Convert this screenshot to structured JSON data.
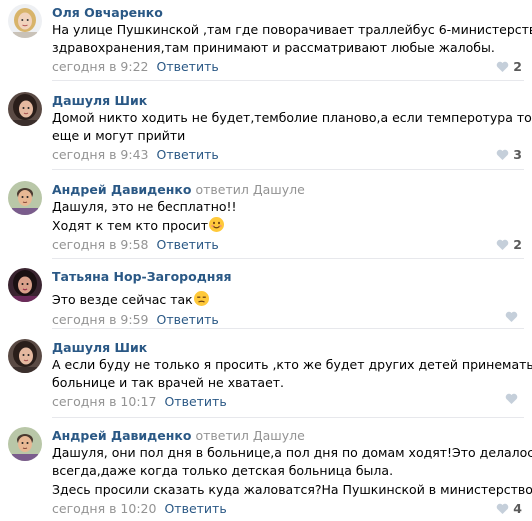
{
  "comments": [
    {
      "author": "Оля Овчаренко",
      "reply_prefix": "",
      "reply_to": "",
      "lines": [
        "На улице Пушкинской ,там где поворачивает траллейбус 6-министерство",
        "здравохранения,там принимают и рассматривают любые жалобы."
      ],
      "date": "сегодня в 9:22",
      "reply_label": "Ответить",
      "likes": "2",
      "avatar_icon": "blonde-woman-avatar-icon"
    },
    {
      "author": "Дашуля Шик",
      "reply_prefix": "",
      "reply_to": "",
      "lines": [
        "Домой никто ходить не будет,темболие планово,а если темперотура тогда",
        "еще и могут прийти"
      ],
      "date": "сегодня в 9:43",
      "reply_label": "Ответить",
      "likes": "3",
      "avatar_icon": "dark-hair-woman-avatar-icon"
    },
    {
      "author": "Андрей Давиденко",
      "reply_prefix": "ответил",
      "reply_to": "Дашуле",
      "lines": [
        "Дашуля, это не бесплатно!!",
        "Ходят к тем кто просит"
      ],
      "emoji_after_line": 1,
      "emoji": "smiling-face-emoji",
      "date": "сегодня в 9:58",
      "reply_label": "Ответить",
      "likes": "2",
      "avatar_icon": "man-avatar-icon"
    },
    {
      "author": "Татьяна Нор-Загородняя",
      "reply_prefix": "",
      "reply_to": "",
      "lines": [
        "Это везде сейчас так"
      ],
      "emoji_after_line": 0,
      "emoji": "unamused-face-emoji",
      "date": "сегодня в 9:59",
      "reply_label": "Ответить",
      "likes": "",
      "avatar_icon": "woman-purple-avatar-icon"
    },
    {
      "author": "Дашуля Шик",
      "reply_prefix": "",
      "reply_to": "",
      "lines": [
        "А если буду не только я просить ,кто же будет других детей принемать?В",
        "больнице и так врачей не хватает."
      ],
      "date": "сегодня в 10:17",
      "reply_label": "Ответить",
      "likes": "",
      "avatar_icon": "dark-hair-woman-avatar-icon"
    },
    {
      "author": "Андрей Давиденко",
      "reply_prefix": "ответил",
      "reply_to": "Дашуле",
      "lines": [
        "Дашуля, они пол дня в больнице,а пол дня по домам ходят!Это делалось",
        "всегда,даже когда только детская больница была.",
        "Здесь просили сказать куда жаловатся?На Пушкинской в министерство"
      ],
      "emoji_after_line": 2,
      "emoji": "sunglasses-face-emoji",
      "date": "сегодня в 10:20",
      "reply_label": "Ответить",
      "likes": "4",
      "avatar_icon": "man-avatar-icon"
    }
  ],
  "colors": {
    "author": "#2a5885",
    "meta": "#939393",
    "separator": "#e7e8ec"
  }
}
